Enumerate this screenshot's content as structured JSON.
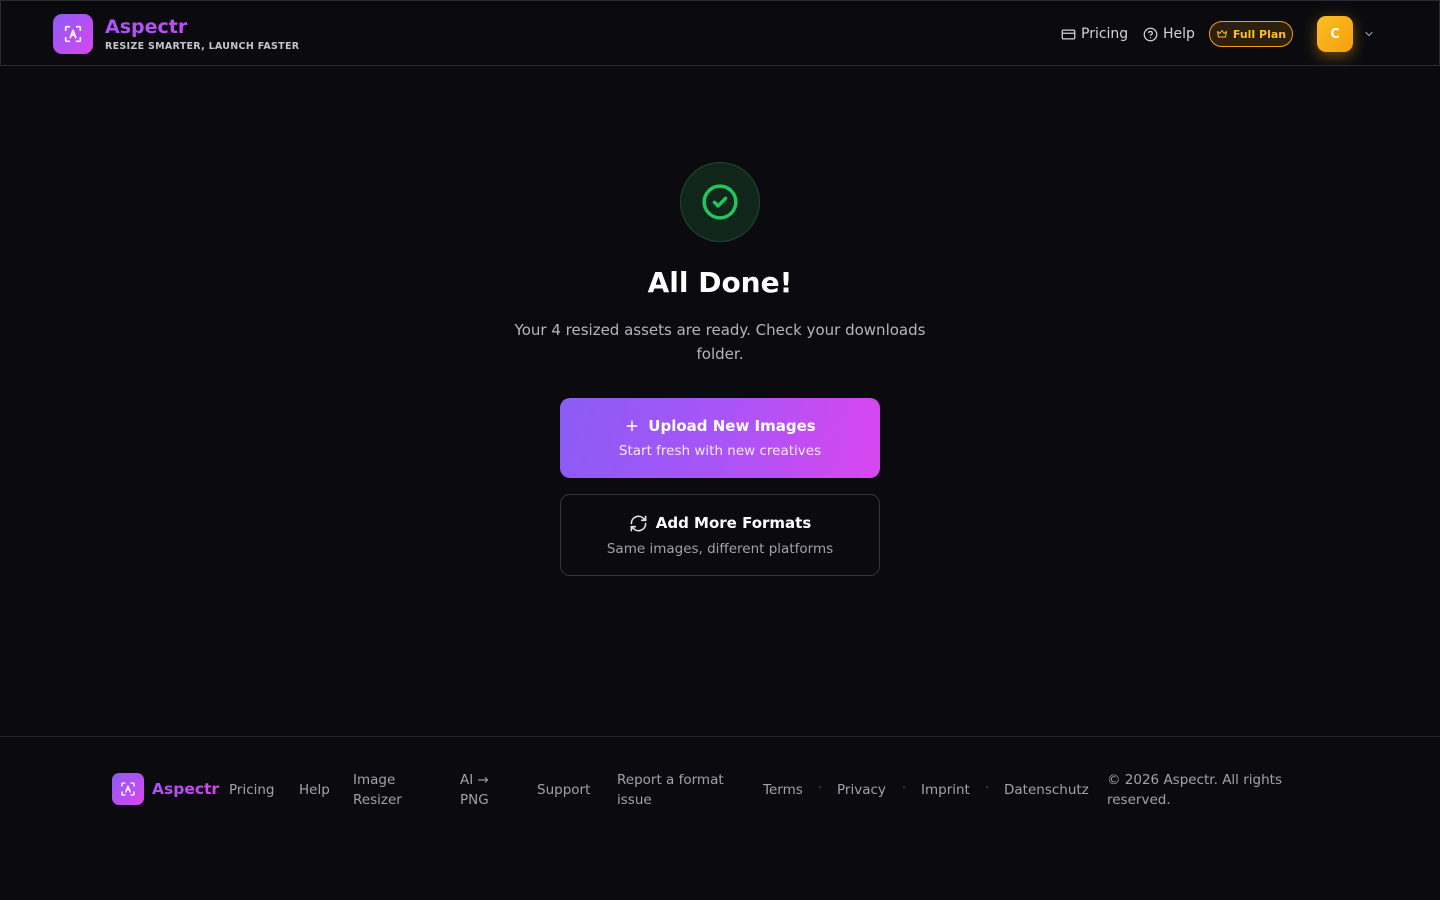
{
  "brand": {
    "name": "Aspectr",
    "tagline": "RESIZE SMARTER, LAUNCH FASTER"
  },
  "nav": {
    "pricing": "Pricing",
    "help": "Help",
    "plan": "Full Plan"
  },
  "user": {
    "initial": "C"
  },
  "main": {
    "title": "All Done!",
    "subtitle": "Your 4 resized assets are ready. Check your downloads folder.",
    "primary": {
      "label": "Upload New Images",
      "sub": "Start fresh with new creatives"
    },
    "secondary": {
      "label": "Add More Formats",
      "sub": "Same images, different platforms"
    }
  },
  "footer": {
    "name": "Aspectr",
    "links": {
      "pricing": "Pricing",
      "help": "Help",
      "image_resizer": "Image Resizer",
      "ai_png": "AI → PNG",
      "support": "Support",
      "report": "Report a format issue",
      "terms": "Terms",
      "privacy": "Privacy",
      "imprint": "Imprint",
      "datenschutz": "Datenschutz"
    },
    "separator": "·",
    "copyright": "© 2026 Aspectr. All rights reserved."
  },
  "colors": {
    "accent_start": "#8b5cf6",
    "accent_end": "#d946ef",
    "success": "#22c55e",
    "plan": "#f59e0b",
    "background": "#0b0b0f"
  },
  "icons": [
    "aspect-ratio-logo-icon",
    "card-icon",
    "help-circle-icon",
    "crown-icon",
    "chevron-down-icon",
    "check-circle-icon",
    "plus-icon",
    "refresh-icon"
  ]
}
